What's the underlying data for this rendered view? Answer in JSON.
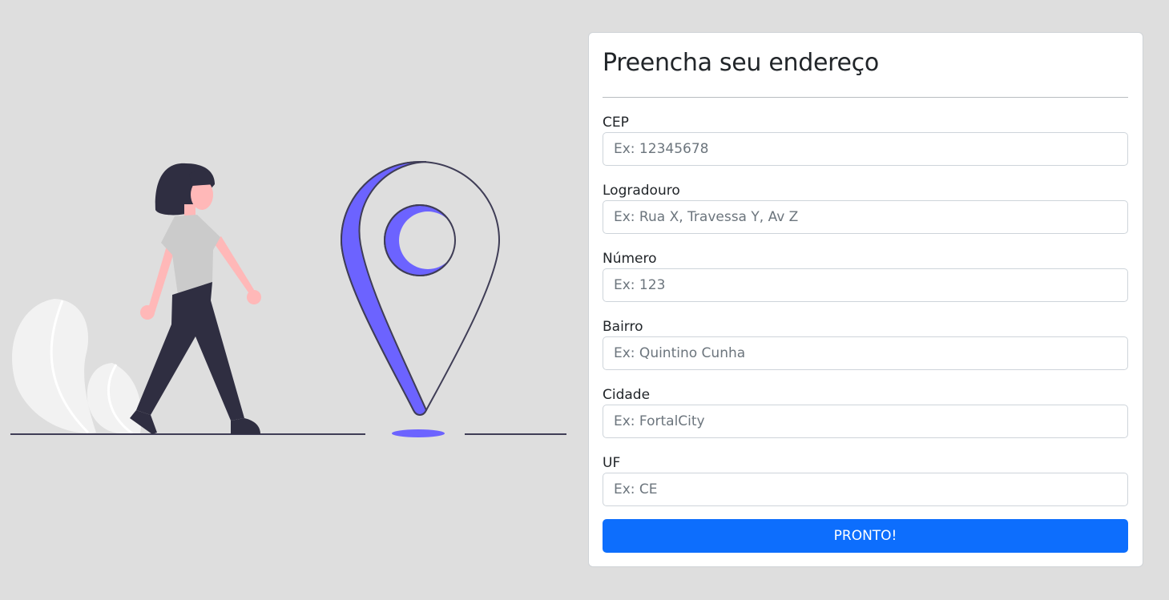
{
  "form": {
    "title": "Preencha seu endereço",
    "fields": [
      {
        "label": "CEP",
        "placeholder": "Ex: 12345678",
        "value": ""
      },
      {
        "label": "Logradouro",
        "placeholder": "Ex: Rua X, Travessa Y, Av Z",
        "value": ""
      },
      {
        "label": "Número",
        "placeholder": "Ex: 123",
        "value": ""
      },
      {
        "label": "Bairro",
        "placeholder": "Ex: Quintino Cunha",
        "value": ""
      },
      {
        "label": "Cidade",
        "placeholder": "Ex: FortalCity",
        "value": ""
      },
      {
        "label": "UF",
        "placeholder": "Ex: CE",
        "value": ""
      }
    ],
    "submit_label": "PRONTO!"
  },
  "colors": {
    "page_background": "#dedede",
    "primary": "#0d6efd",
    "illustration_accent": "#6c63ff",
    "illustration_dark": "#2f2e41",
    "illustration_skin": "#ffb8b8"
  },
  "illustration": {
    "icons": [
      "woman-walking-illustration",
      "location-pin-icon",
      "plant-illustration"
    ]
  }
}
